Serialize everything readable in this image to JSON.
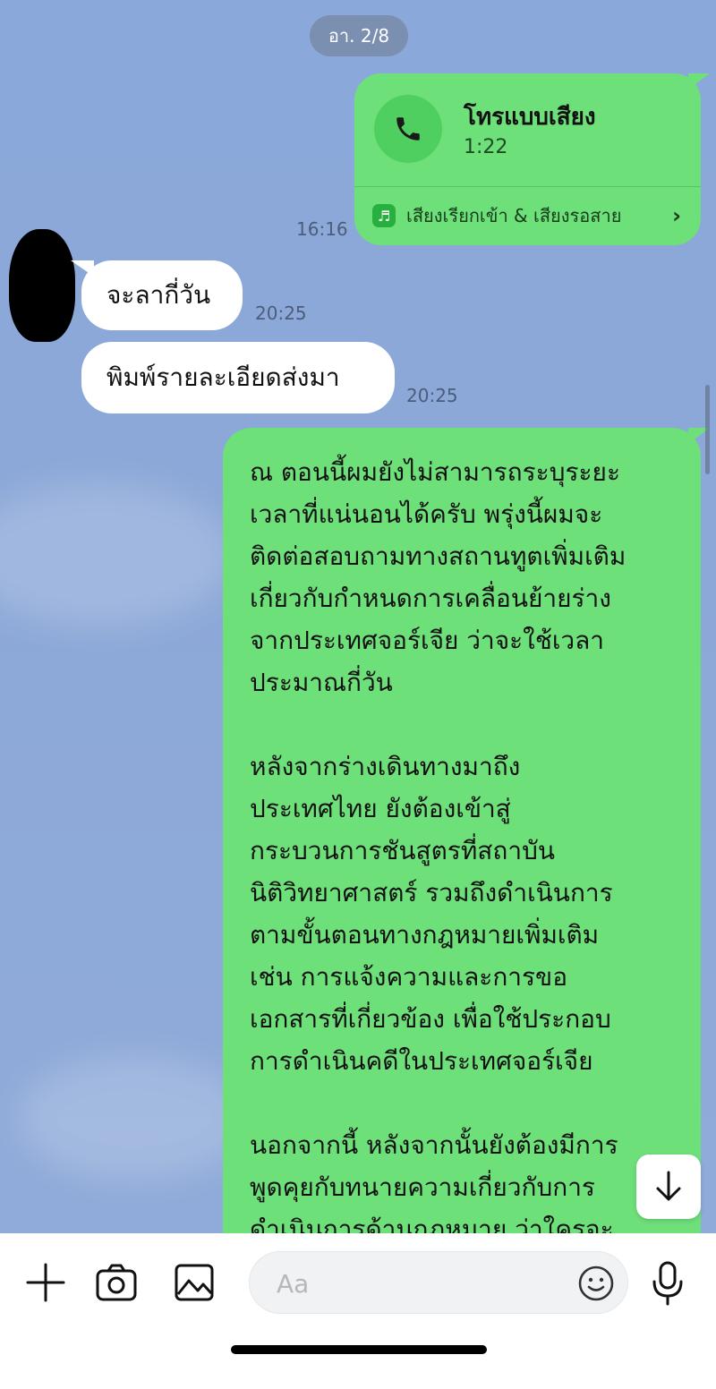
{
  "date_separator": "อา. 2/8",
  "call": {
    "title": "โทรแบบเสียง",
    "duration": "1:22",
    "ringtone_link": "เสียงเรียกเข้า & เสียงรอสาย",
    "time": "16:16"
  },
  "incoming": [
    {
      "text": "จะลากี่วัน",
      "time": "20:25"
    },
    {
      "text": "พิมพ์รายละเอียดส่งมา",
      "time": "20:25"
    }
  ],
  "outgoing_message": {
    "lines": [
      "ณ ตอนนี้ผมยังไม่สามารถระบุระยะ",
      "เวลาที่แน่นอนได้ครับ พรุ่งนี้ผมจะ",
      "ติดต่อสอบถามทางสถานทูตเพิ่มเติม",
      "เกี่ยวกับกำหนดการเคลื่อนย้ายร่าง",
      "จากประเทศจอร์เจีย ว่าจะใช้เวลา",
      "ประมาณกี่วัน",
      "",
      "หลังจากร่างเดินทางมาถึง",
      "ประเทศไทย ยังต้องเข้าสู่",
      "กระบวนการชันสูตรที่สถาบัน",
      "นิติวิทยาศาสตร์ รวมถึงดำเนินการ",
      "ตามขั้นตอนทางกฎหมายเพิ่มเติม",
      "เช่น การแจ้งความและการขอ",
      "เอกสารที่เกี่ยวข้อง เพื่อใช้ประกอบ",
      "การดำเนินคดีในประเทศจอร์เจีย",
      "",
      "นอกจากนี้ หลังจากนั้นยังต้องมีการ",
      "พูดคุยกับทนายความเกี่ยวกับการ",
      "ดำเนินการด้านกฎหมาย ว่าใครจะ"
    ]
  },
  "input": {
    "placeholder": "Aa"
  },
  "icons": {
    "add": "plus-icon",
    "camera": "camera-icon",
    "gallery": "image-icon",
    "emoji": "emoji-icon",
    "mic": "microphone-icon",
    "scroll": "arrow-down-icon",
    "phone": "phone-icon",
    "ringtone": "music-note-icon"
  },
  "colors": {
    "chat_background": "#8aa7d8",
    "outgoing_bubble": "#6ee07a",
    "incoming_bubble": "#ffffff"
  }
}
